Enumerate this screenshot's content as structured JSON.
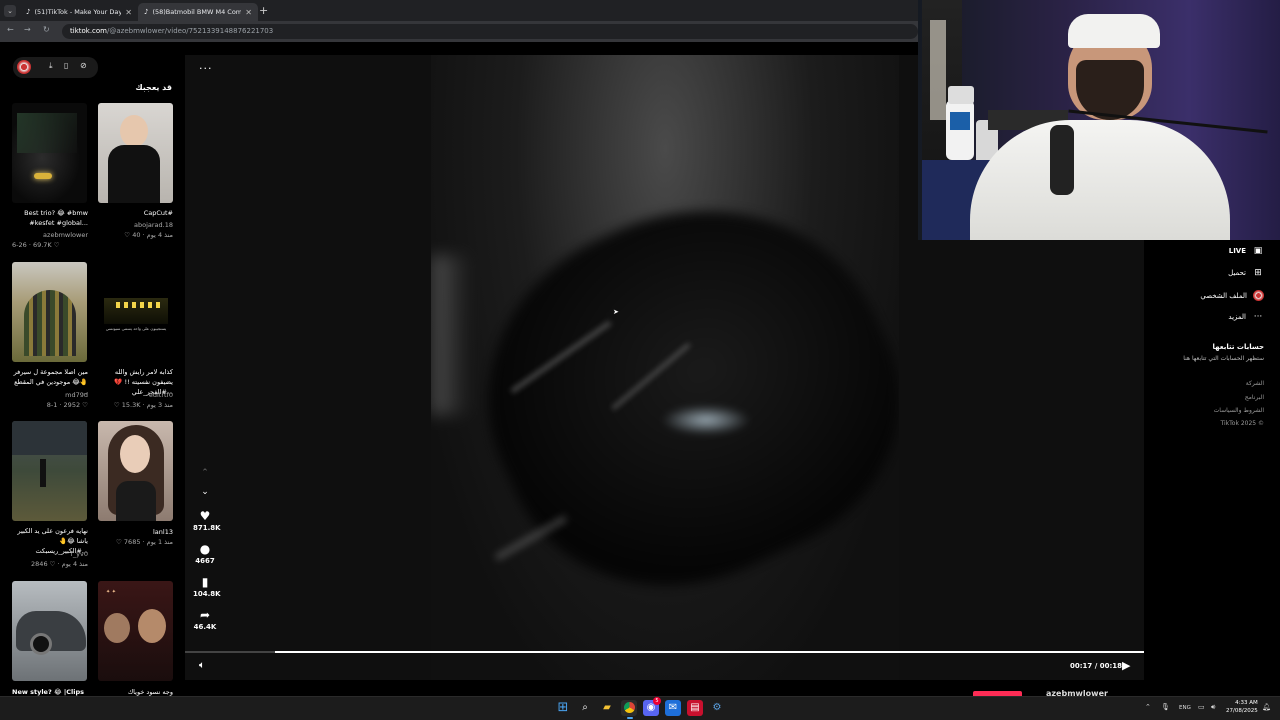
{
  "browser": {
    "tabs": [
      {
        "label": "(51)TikTok - Make Your Day",
        "active": false
      },
      {
        "label": "(58)Batmobil BMW M4 Compe",
        "active": true
      }
    ],
    "url_host": "tiktok.com",
    "url_rest": "/@azebmwlower/video/7521339148876221703"
  },
  "left": {
    "title": "قد يعجبك",
    "cards": [
      {
        "caption": "Best trio? 😂 #bmw #kesfet #global...",
        "author": "azebmwlower",
        "meta": "6-26 · 69.7K ♡"
      },
      {
        "caption": "CapCut#",
        "author": "abojarad.18",
        "meta": "♡ 40 · منذ 4 يوم"
      },
      {
        "caption": "مين اصلا مجموعة ل سيرفر موجودين في المقطع 😂🤚 ...",
        "author": "md79d",
        "meta": "8-1 · 2952 ♡"
      },
      {
        "caption": "كذابه لامر رايش والله يضيفون نفسيته !! 💔 #الفجر_علي...",
        "author": "editrtf0",
        "meta": "♡ 15.3K · منذ 3 يوم"
      },
      {
        "caption": "نهايه فرعون على يد الكبير ياشا 😂🤚 #الكبير_ريسبكت...",
        "author": "f_yv0",
        "meta": "2846 ♡ · منذ 4 يوم"
      },
      {
        "caption": "lanl13",
        "author": "",
        "meta": "♡ 7685 · منذ 1 يوم"
      },
      {
        "caption": "New style? 😂 |Clips",
        "author": "",
        "meta": ""
      },
      {
        "caption": "وجه نسود خوياك #البشلويت",
        "author": "",
        "meta": ""
      }
    ],
    "thumb_overlay_text": "يستجيبون على واحد يسمى سبوتسي"
  },
  "video": {
    "likes": "871.8K",
    "comments": "4667",
    "saves": "104.8K",
    "shares": "46.4K",
    "time": "00:17 / 00:18",
    "progress": 0.094,
    "author_peek": "azebmwlower"
  },
  "sidebar": {
    "items": [
      {
        "label": "LIVE",
        "icon": "live-icon"
      },
      {
        "label": "تحميل",
        "icon": "upload-icon"
      },
      {
        "label": "الملف الشخصي",
        "icon": "avatar-icon"
      },
      {
        "label": "المزيد",
        "icon": "more-icon"
      }
    ],
    "following_title": "حسابات تتابعها",
    "following_sub": "ستظهر الحسابات التي تتابعها هنا",
    "footer": [
      "الشركة",
      "البرنامج",
      "الشروط والسياسات",
      "TikTok 2025 ©"
    ]
  },
  "taskbar": {
    "lang": "ENG",
    "time": "4:33 AM",
    "date": "27/08/2025",
    "chat_badge": "5"
  }
}
